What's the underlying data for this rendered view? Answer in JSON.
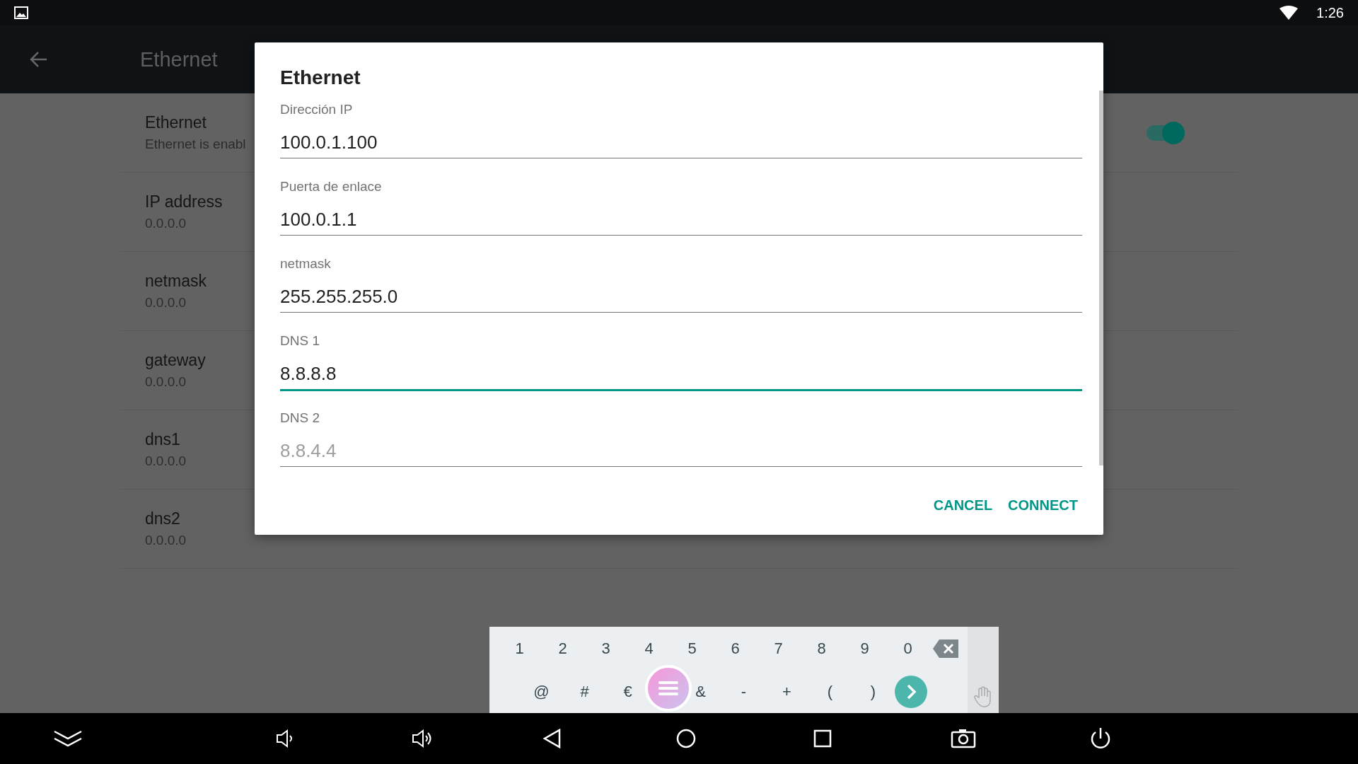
{
  "status_bar": {
    "time": "1:26"
  },
  "app_bar": {
    "title": "Ethernet"
  },
  "settings": [
    {
      "title": "Ethernet",
      "summary": "Ethernet is enabl",
      "toggle": true
    },
    {
      "title": "IP address",
      "summary": "0.0.0.0"
    },
    {
      "title": "netmask",
      "summary": "0.0.0.0"
    },
    {
      "title": "gateway",
      "summary": "0.0.0.0"
    },
    {
      "title": "dns1",
      "summary": "0.0.0.0"
    },
    {
      "title": "dns2",
      "summary": "0.0.0.0"
    }
  ],
  "dialog": {
    "title": "Ethernet",
    "fields": [
      {
        "label": "Dirección IP",
        "value": "100.0.1.100",
        "focused": false
      },
      {
        "label": "Puerta de enlace",
        "value": "100.0.1.1",
        "focused": false
      },
      {
        "label": "netmask",
        "value": "255.255.255.0",
        "focused": false
      },
      {
        "label": "DNS 1",
        "value": "8.8.8.8",
        "focused": true
      },
      {
        "label": "DNS 2",
        "placeholder": "8.8.4.4",
        "focused": false
      }
    ],
    "buttons": [
      "CANCEL",
      "CONNECT"
    ]
  },
  "keyboard": {
    "rows": [
      [
        "1",
        "2",
        "3",
        "4",
        "5",
        "6",
        "7",
        "8",
        "9",
        "0"
      ],
      [
        "@",
        "#",
        "€",
        "&",
        "-",
        "+",
        "(",
        ")"
      ]
    ]
  }
}
